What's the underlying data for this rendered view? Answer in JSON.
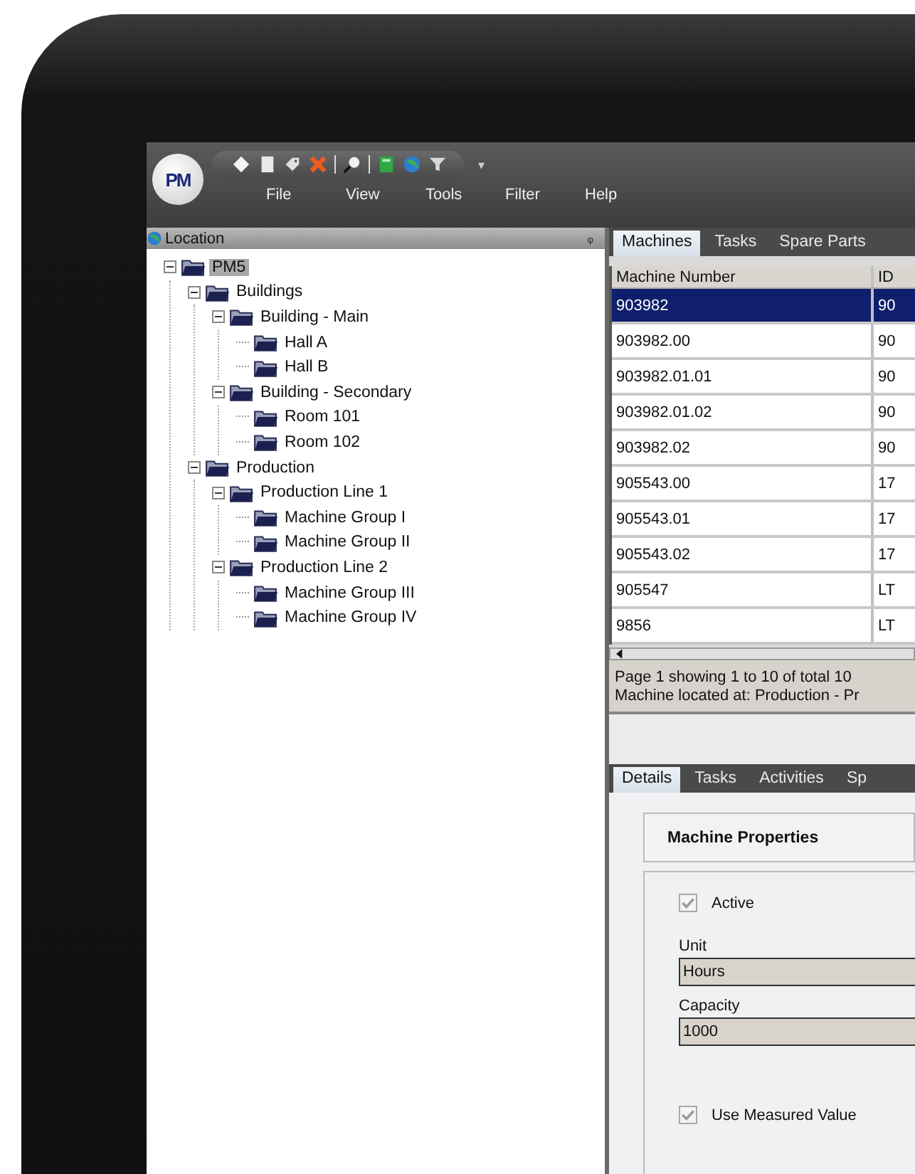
{
  "toolbar": {
    "logo": "PM",
    "overflow": "▾"
  },
  "menu": [
    "File",
    "View",
    "Tools",
    "Filter",
    "Help"
  ],
  "location_panel": {
    "title": "Location",
    "pin": "ᵩ",
    "tree": [
      {
        "label": "PM5",
        "expanded": true,
        "selected": true,
        "children": [
          {
            "label": "Buildings",
            "expanded": true,
            "selected": false,
            "children": [
              {
                "label": "Building - Main",
                "expanded": true,
                "selected": false,
                "children": [
                  {
                    "label": "Hall A",
                    "selected": false
                  },
                  {
                    "label": "Hall B",
                    "selected": false
                  }
                ]
              },
              {
                "label": "Building - Secondary",
                "expanded": true,
                "selected": false,
                "children": [
                  {
                    "label": "Room 101",
                    "selected": false
                  },
                  {
                    "label": "Room 102",
                    "selected": false
                  }
                ]
              }
            ]
          },
          {
            "label": "Production",
            "expanded": true,
            "selected": false,
            "children": [
              {
                "label": "Production Line 1",
                "expanded": true,
                "selected": false,
                "children": [
                  {
                    "label": "Machine Group I",
                    "selected": false
                  },
                  {
                    "label": "Machine Group II",
                    "selected": false
                  }
                ]
              },
              {
                "label": "Production Line 2",
                "expanded": true,
                "selected": false,
                "children": [
                  {
                    "label": "Machine Group III",
                    "selected": false
                  },
                  {
                    "label": "Machine Group IV",
                    "selected": false
                  }
                ]
              }
            ]
          }
        ]
      }
    ]
  },
  "list_tabs": [
    {
      "label": "Machines",
      "selected": true
    },
    {
      "label": "Tasks",
      "selected": false
    },
    {
      "label": "Spare Parts",
      "selected": false
    }
  ],
  "table": {
    "columns": [
      "Machine Number",
      "ID"
    ],
    "rows": [
      {
        "cells": [
          "903982",
          "90"
        ],
        "selected": true
      },
      {
        "cells": [
          "903982.00",
          "90"
        ],
        "selected": false
      },
      {
        "cells": [
          "903982.01.01",
          "90"
        ],
        "selected": false
      },
      {
        "cells": [
          "903982.01.02",
          "90"
        ],
        "selected": false
      },
      {
        "cells": [
          "903982.02",
          "90"
        ],
        "selected": false
      },
      {
        "cells": [
          "905543.00",
          "17"
        ],
        "selected": false
      },
      {
        "cells": [
          "905543.01",
          "17"
        ],
        "selected": false
      },
      {
        "cells": [
          "905543.02",
          "17"
        ],
        "selected": false
      },
      {
        "cells": [
          "905547",
          "LT"
        ],
        "selected": false
      },
      {
        "cells": [
          "9856",
          "LT"
        ],
        "selected": false
      }
    ]
  },
  "status": [
    "Page 1 showing 1 to 10 of total 10",
    "Machine located at: Production - Pr"
  ],
  "detail_tabs": [
    {
      "label": "Details",
      "selected": true
    },
    {
      "label": "Tasks",
      "selected": false
    },
    {
      "label": "Activities",
      "selected": false
    },
    {
      "label": "Sp",
      "selected": false
    }
  ],
  "details": {
    "heading": "Machine Properties",
    "active": {
      "label": "Active",
      "checked": true
    },
    "unit": {
      "label": "Unit",
      "value": "Hours"
    },
    "capacity": {
      "label": "Capacity",
      "value": "1000"
    },
    "use_measured": {
      "label": "Use Measured Value",
      "checked": true
    }
  }
}
